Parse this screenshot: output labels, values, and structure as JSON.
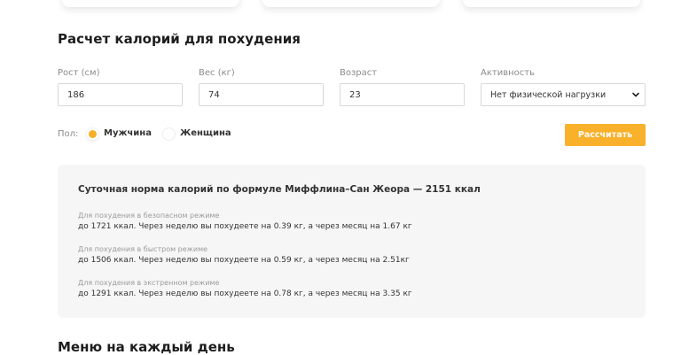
{
  "calculator": {
    "title": "Расчет калорий для похудения",
    "fields": {
      "height": {
        "label": "Рост (см)",
        "value": "186"
      },
      "weight": {
        "label": "Вес (кг)",
        "value": "74"
      },
      "age": {
        "label": "Возраст",
        "value": "23"
      },
      "activity": {
        "label": "Активность",
        "selected": "Нет физической нагрузки"
      }
    },
    "gender": {
      "label": "Пол:",
      "options": [
        {
          "label": "Мужчина",
          "checked": true
        },
        {
          "label": "Женщина",
          "checked": false
        }
      ]
    },
    "submit_label": "Рассчитать"
  },
  "result": {
    "title": "Суточная норма калорий по формуле Миффлина–Сан Жеора — 2151 ккал",
    "modes": [
      {
        "caption": "Для похудения в безопасном режиме",
        "text": "до 1721 ккал. Через неделю вы похудеете на 0.39 кг, а через месяц на 1.67 кг"
      },
      {
        "caption": "Для похудения в быстром режиме",
        "text": "до 1506 ккал. Через неделю вы похудеете на 0.59 кг, а через месяц на 2.51кг"
      },
      {
        "caption": "Для похудения в экстренном режиме",
        "text": "до 1291 ккал. Через неделю вы похудеете на 0.78 кг, а через месяц на 3.35 кг"
      }
    ]
  },
  "menu": {
    "title": "Меню на каждый день"
  },
  "colors": {
    "accent": "#f9b02a",
    "result_bg": "#f6f6f6",
    "label_gray": "#8b8b8b"
  },
  "icons": {
    "select_arrow": "chevron-down-icon",
    "radio_selected": "radio-checked-icon"
  }
}
